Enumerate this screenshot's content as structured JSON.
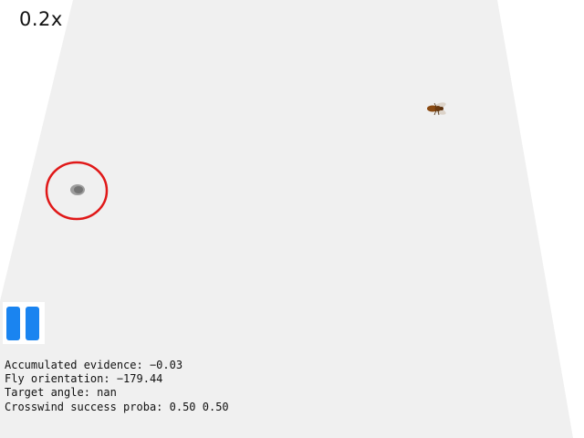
{
  "playback": {
    "speed_label": "0.2x",
    "pause_button_color": "#1a84f0"
  },
  "readouts": [
    {
      "label": "Accumulated evidence:",
      "value": "−0.03"
    },
    {
      "label": "Fly orientation:",
      "value": "−179.44"
    },
    {
      "label": "Target angle:",
      "value": "nan"
    },
    {
      "label": "Crosswind success proba:",
      "value": "0.50 0.50"
    }
  ],
  "arena": {
    "floor_color": "#f0f0f0",
    "background_color": "#ffffff"
  },
  "target": {
    "marker_color": "#e01818",
    "spot_color": "#888888"
  },
  "fly": {
    "icon": "fly-icon",
    "body_color": "#8a4a12"
  }
}
